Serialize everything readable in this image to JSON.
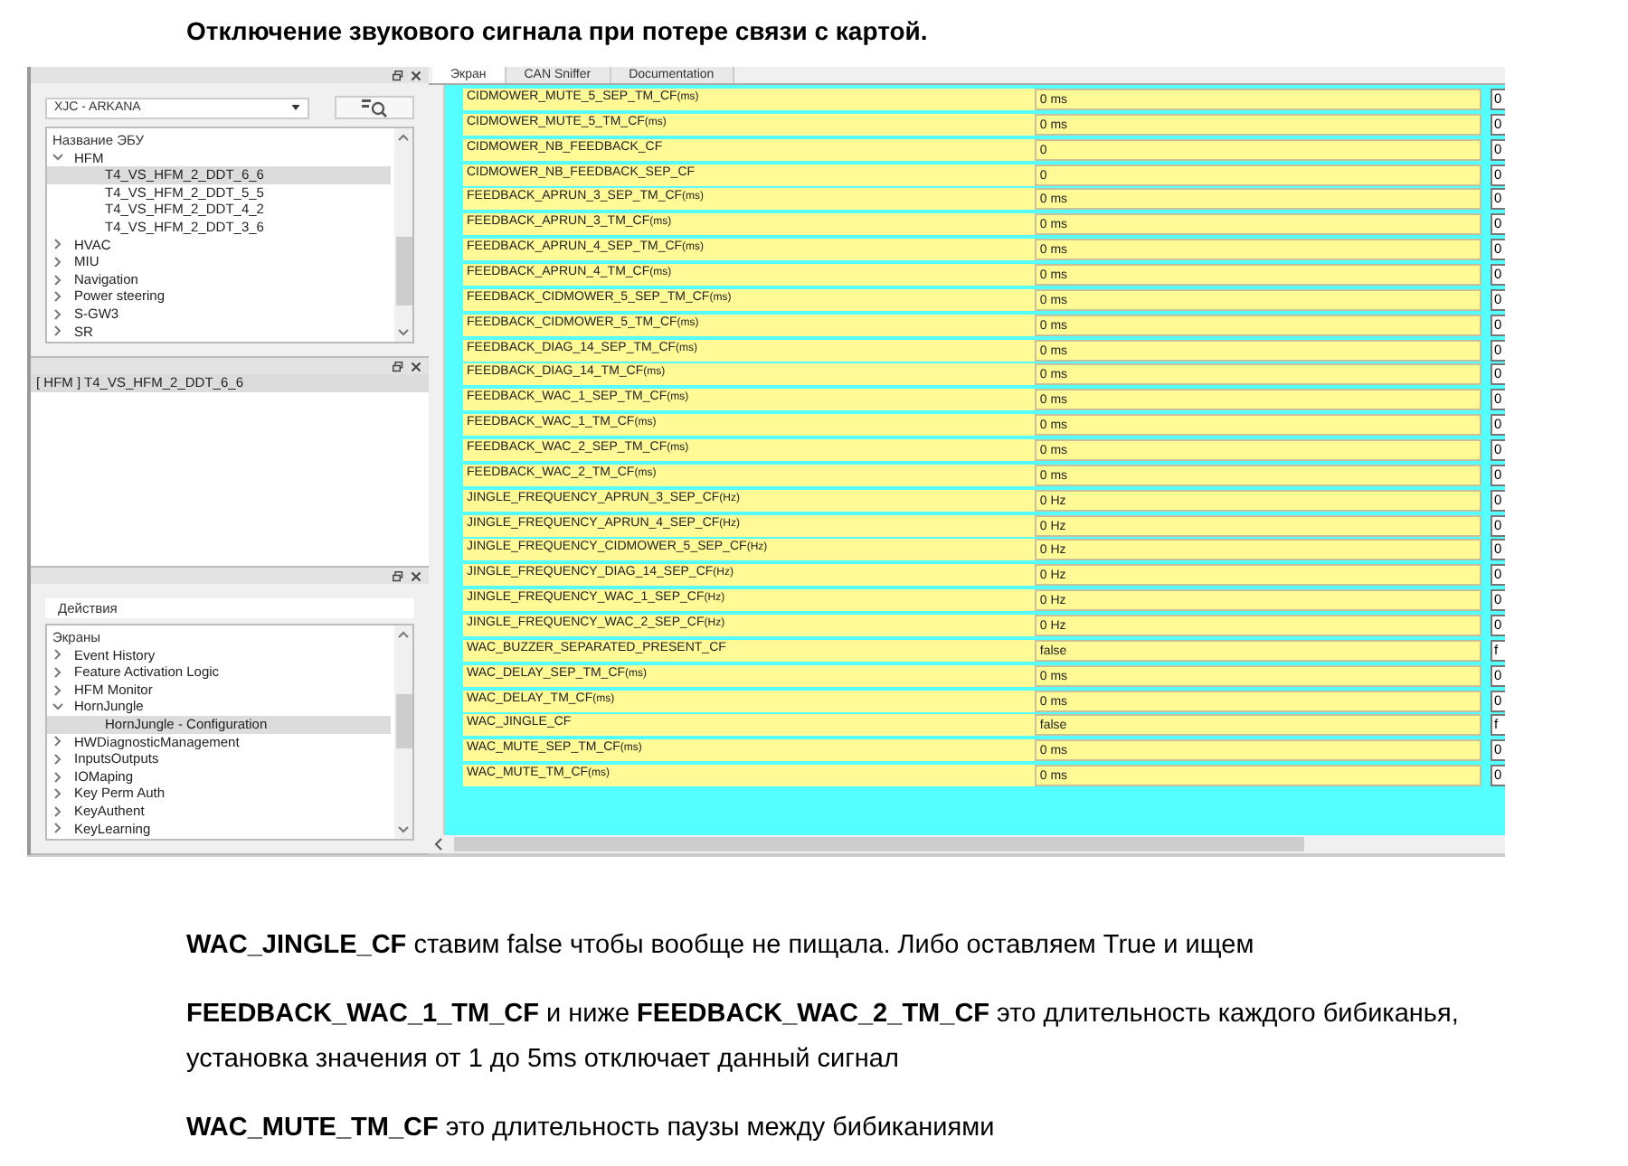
{
  "heading": "Отключение звукового сигнала при потере связи с картой.",
  "left_panel": {
    "ecu_select": {
      "value": "XJC - ARKANA"
    },
    "ecu_tree": {
      "header": "Название ЭБУ",
      "items": [
        {
          "label": "HFM",
          "expanded": true,
          "children": [
            {
              "label": "T4_VS_HFM_2_DDT_6_6",
              "selected": true
            },
            {
              "label": "T4_VS_HFM_2_DDT_5_5",
              "selected": false
            },
            {
              "label": "T4_VS_HFM_2_DDT_4_2",
              "selected": false
            },
            {
              "label": "T4_VS_HFM_2_DDT_3_6",
              "selected": false
            }
          ]
        },
        {
          "label": "HVAC",
          "expanded": false
        },
        {
          "label": "MIU",
          "expanded": false
        },
        {
          "label": "Navigation",
          "expanded": false
        },
        {
          "label": "Power steering",
          "expanded": false
        },
        {
          "label": "S-GW3",
          "expanded": false
        },
        {
          "label": "SR",
          "expanded": false
        }
      ]
    },
    "session_list": [
      {
        "label": "[ HFM ] T4_VS_HFM_2_DDT_6_6",
        "selected": true
      }
    ],
    "actions": {
      "title": "Действия",
      "header": "Экраны",
      "items": [
        {
          "label": "Event History",
          "expanded": false
        },
        {
          "label": "Feature Activation Logic",
          "expanded": false
        },
        {
          "label": "HFM Monitor",
          "expanded": false
        },
        {
          "label": "HornJungle",
          "expanded": true,
          "children": [
            {
              "label": "HornJungle - Configuration",
              "selected": true
            }
          ]
        },
        {
          "label": "HWDiagnosticManagement",
          "expanded": false
        },
        {
          "label": "InputsOutputs",
          "expanded": false
        },
        {
          "label": "IOMaping",
          "expanded": false
        },
        {
          "label": "Key Perm Auth",
          "expanded": false
        },
        {
          "label": "KeyAuthent",
          "expanded": false
        },
        {
          "label": "KeyLearning",
          "expanded": false
        }
      ]
    }
  },
  "tabs": [
    {
      "label": "Экран",
      "selected": true
    },
    {
      "label": "CAN Sniffer",
      "selected": false
    },
    {
      "label": "Documentation",
      "selected": false
    }
  ],
  "params": [
    {
      "name": "CIDMOWER_MUTE_5_SEP_TM_CF",
      "unit": "(ms)",
      "value": "0 ms",
      "column_3": "0"
    },
    {
      "name": "CIDMOWER_MUTE_5_TM_CF",
      "unit": "(ms)",
      "value": "0 ms",
      "column_3": "0"
    },
    {
      "name": "CIDMOWER_NB_FEEDBACK_CF",
      "value": "0",
      "column_3": "0"
    },
    {
      "name": "CIDMOWER_NB_FEEDBACK_SEP_CF",
      "value": "0",
      "column_3": "0"
    },
    {
      "name": "FEEDBACK_APRUN_3_SEP_TM_CF",
      "unit": "(ms)",
      "value": "0 ms",
      "column_3": "0"
    },
    {
      "name": "FEEDBACK_APRUN_3_TM_CF",
      "unit": "(ms)",
      "value": "0 ms",
      "column_3": "0"
    },
    {
      "name": "FEEDBACK_APRUN_4_SEP_TM_CF",
      "unit": "(ms)",
      "value": "0 ms",
      "column_3": "0"
    },
    {
      "name": "FEEDBACK_APRUN_4_TM_CF",
      "unit": "(ms)",
      "value": "0 ms",
      "column_3": "0"
    },
    {
      "name": "FEEDBACK_CIDMOWER_5_SEP_TM_CF",
      "unit": "(ms)",
      "value": "0 ms",
      "column_3": "0"
    },
    {
      "name": "FEEDBACK_CIDMOWER_5_TM_CF",
      "unit": "(ms)",
      "value": "0 ms",
      "column_3": "0"
    },
    {
      "name": "FEEDBACK_DIAG_14_SEP_TM_CF",
      "unit": "(ms)",
      "value": "0 ms",
      "column_3": "0"
    },
    {
      "name": "FEEDBACK_DIAG_14_TM_CF",
      "unit": "(ms)",
      "value": "0 ms",
      "column_3": "0"
    },
    {
      "name": "FEEDBACK_WAC_1_SEP_TM_CF",
      "unit": "(ms)",
      "value": "0 ms",
      "column_3": "0"
    },
    {
      "name": "FEEDBACK_WAC_1_TM_CF",
      "unit": "(ms)",
      "value": "0 ms",
      "column_3": "0"
    },
    {
      "name": "FEEDBACK_WAC_2_SEP_TM_CF",
      "unit": "(ms)",
      "value": "0 ms",
      "column_3": "0"
    },
    {
      "name": "FEEDBACK_WAC_2_TM_CF",
      "unit": "(ms)",
      "value": "0 ms",
      "column_3": "0"
    },
    {
      "name": "JINGLE_FREQUENCY_APRUN_3_SEP_CF",
      "unit": "(Hz)",
      "value": "0 Hz",
      "column_3": "0"
    },
    {
      "name": "JINGLE_FREQUENCY_APRUN_4_SEP_CF",
      "unit": "(Hz)",
      "value": "0 Hz",
      "column_3": "0"
    },
    {
      "name": "JINGLE_FREQUENCY_CIDMOWER_5_SEP_CF",
      "unit": "(Hz)",
      "value": "0 Hz",
      "column_3": "0"
    },
    {
      "name": "JINGLE_FREQUENCY_DIAG_14_SEP_CF",
      "unit": "(Hz)",
      "value": "0 Hz",
      "column_3": "0"
    },
    {
      "name": "JINGLE_FREQUENCY_WAC_1_SEP_CF",
      "unit": "(Hz)",
      "value": "0 Hz",
      "column_3": "0"
    },
    {
      "name": "JINGLE_FREQUENCY_WAC_2_SEP_CF",
      "unit": "(Hz)",
      "value": "0 Hz",
      "column_3": "0"
    },
    {
      "name": "WAC_BUZZER_SEPARATED_PRESENT_CF",
      "value": "false",
      "column_3": "f"
    },
    {
      "name": "WAC_DELAY_SEP_TM_CF",
      "unit": "(ms)",
      "value": "0 ms",
      "column_3": "0"
    },
    {
      "name": "WAC_DELAY_TM_CF",
      "unit": "(ms)",
      "value": "0 ms",
      "column_3": "0"
    },
    {
      "name": "WAC_JINGLE_CF",
      "value": "false",
      "column_3": "f"
    },
    {
      "name": "WAC_MUTE_SEP_TM_CF",
      "unit": "(ms)",
      "value": "0 ms",
      "column_3": "0"
    },
    {
      "name": "WAC_MUTE_TM_CF",
      "unit": "(ms)",
      "value": "0 ms",
      "column_3": "0"
    }
  ],
  "notes": [
    "**WAC_JINGLE_CF** ставим false чтобы вообще не пищала. Либо оставляем True и ищем",
    "**FEEDBACK_WAC_1_TM_CF** и ниже **FEEDBACK_WAC_2_TM_CF** это длительность каждого бибиканья, установка значения от 1 до 5ms отключает данный сигнал",
    "**WAC_MUTE_TM_CF** это длительность паузы между бибиканиями"
  ]
}
